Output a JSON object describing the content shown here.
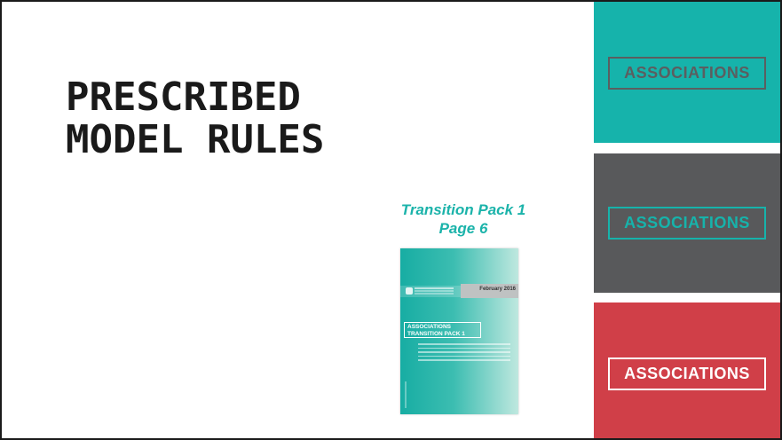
{
  "slide": {
    "title_lines": [
      "PRESCRIBED",
      "MODEL RULES"
    ],
    "reference_lines": [
      "Transition Pack 1",
      "Page 6"
    ]
  },
  "cover": {
    "date": "February 2016",
    "label_line1": "ASSOCIATIONS",
    "label_line2": "TRANSITION PACK 1"
  },
  "panels": [
    {
      "label": "ASSOCIATIONS",
      "background": "#16b3ab",
      "text_color": "#5b5e60"
    },
    {
      "label": "ASSOCIATIONS",
      "background": "#58595b",
      "text_color": "#16b3ab"
    },
    {
      "label": "ASSOCIATIONS",
      "background": "#d03f48",
      "text_color": "#ffffff"
    }
  ]
}
